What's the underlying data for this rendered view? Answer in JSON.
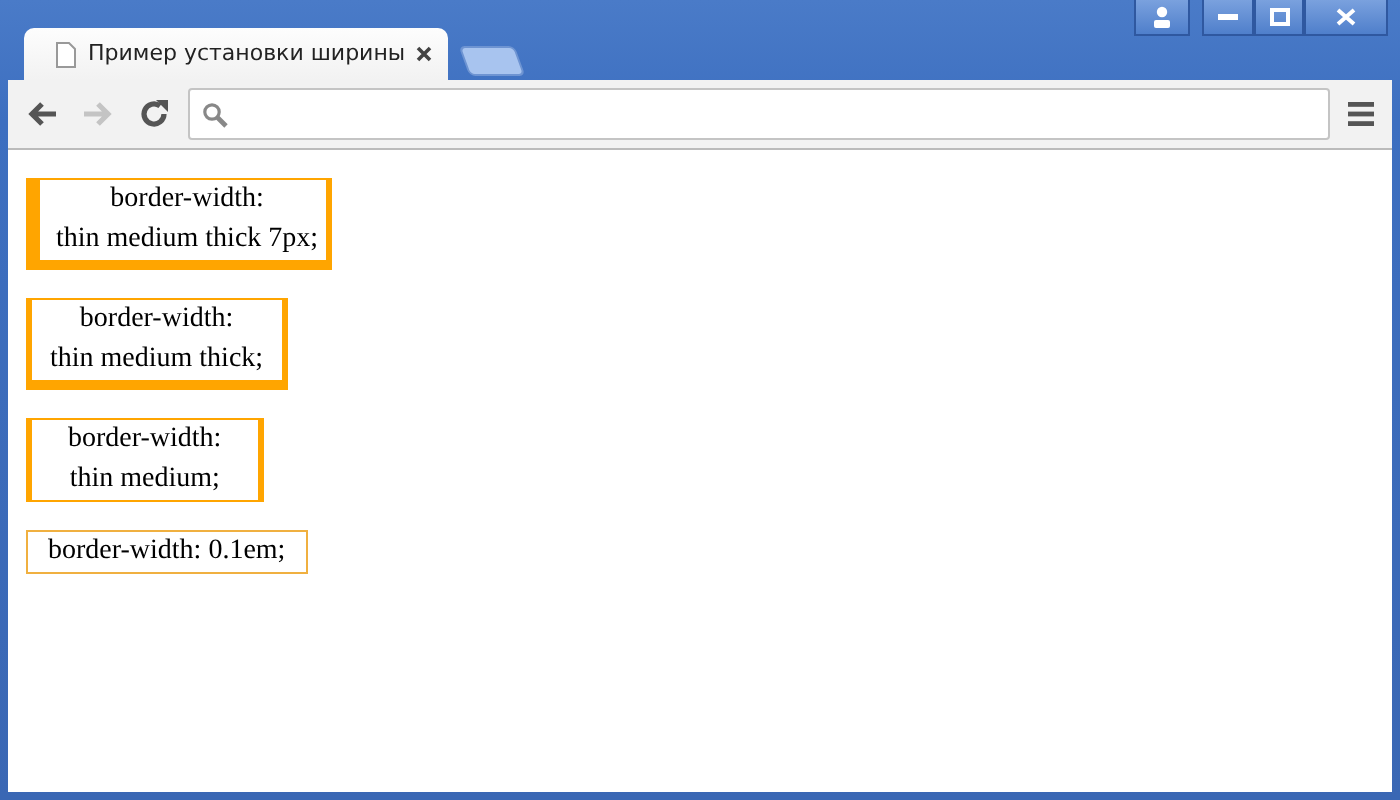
{
  "window": {
    "tabs": [
      {
        "title": "Пример установки ширины",
        "selected": true,
        "kind": "page"
      },
      {
        "kind": "new"
      }
    ]
  },
  "boxes": [
    {
      "lines": [
        "border-width:",
        "thin medium thick 7px;"
      ],
      "kind": "four"
    },
    {
      "lines": [
        "border-width:",
        "thin medium thick;"
      ],
      "kind": "three"
    },
    {
      "lines": [
        "border-width:",
        "thin medium;"
      ],
      "kind": "two"
    },
    {
      "lines": [
        "border-width: 0.1em;"
      ],
      "kind": "one"
    }
  ]
}
